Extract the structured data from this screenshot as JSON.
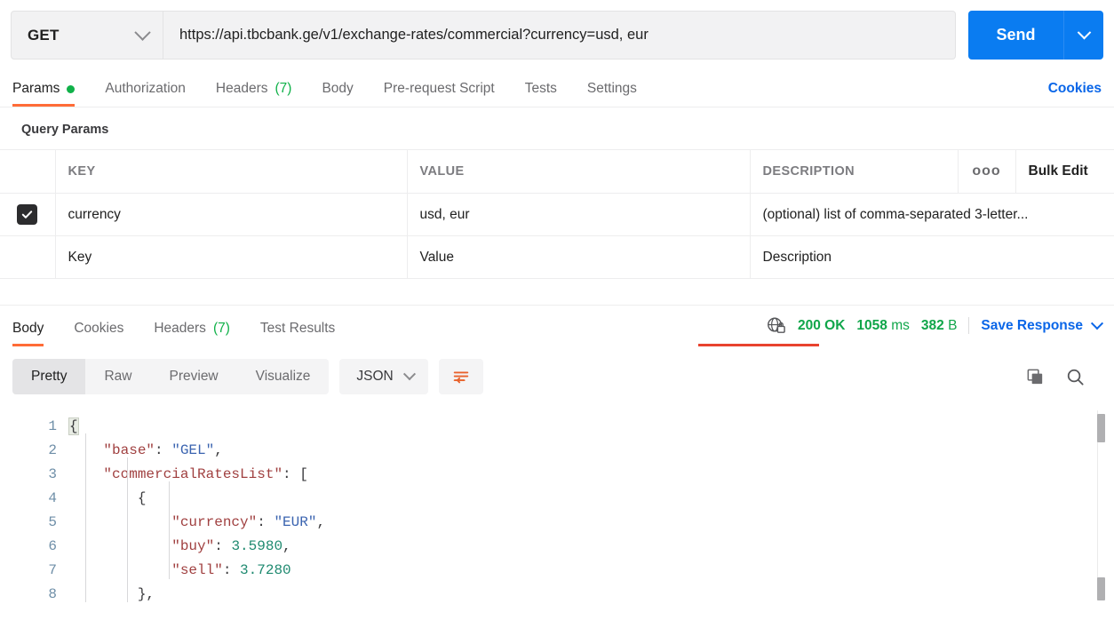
{
  "request": {
    "method": "GET",
    "url": "https://api.tbcbank.ge/v1/exchange-rates/commercial?currency=usd, eur",
    "send_label": "Send",
    "tabs": [
      {
        "label": "Params",
        "badge": "",
        "active": true,
        "dot": true
      },
      {
        "label": "Authorization",
        "badge": "",
        "active": false,
        "dot": false
      },
      {
        "label": "Headers",
        "badge": "(7)",
        "active": false,
        "dot": false
      },
      {
        "label": "Body",
        "badge": "",
        "active": false,
        "dot": false
      },
      {
        "label": "Pre-request Script",
        "badge": "",
        "active": false,
        "dot": false
      },
      {
        "label": "Tests",
        "badge": "",
        "active": false,
        "dot": false
      },
      {
        "label": "Settings",
        "badge": "",
        "active": false,
        "dot": false
      }
    ],
    "cookies_link": "Cookies"
  },
  "query_params": {
    "section_title": "Query Params",
    "columns": [
      "KEY",
      "VALUE",
      "DESCRIPTION"
    ],
    "options_glyph": "ooo",
    "bulk_edit_label": "Bulk Edit",
    "rows": [
      {
        "checked": true,
        "key": "currency",
        "value": "usd, eur",
        "description": "(optional) list of comma-separated 3-letter..."
      }
    ],
    "empty_row": {
      "key_placeholder": "Key",
      "value_placeholder": "Value",
      "description_placeholder": "Description"
    }
  },
  "response": {
    "tabs": [
      {
        "label": "Body",
        "badge": "",
        "active": true
      },
      {
        "label": "Cookies",
        "badge": "",
        "active": false
      },
      {
        "label": "Headers",
        "badge": "(7)",
        "active": false
      },
      {
        "label": "Test Results",
        "badge": "",
        "active": false
      }
    ],
    "status_code": "200 OK",
    "time": "1058",
    "time_unit": "ms",
    "size": "382",
    "size_unit": "B",
    "save_response_label": "Save Response",
    "security_icon": "globe-lock-icon",
    "view_modes": [
      {
        "label": "Pretty",
        "active": true
      },
      {
        "label": "Raw",
        "active": false
      },
      {
        "label": "Preview",
        "active": false
      },
      {
        "label": "Visualize",
        "active": false
      }
    ],
    "format": "JSON",
    "wrap_icon": "word-wrap-icon",
    "copy_icon": "copy-icon",
    "search_icon": "search-icon",
    "body_lines": [
      {
        "num": "1",
        "tokens": [
          {
            "t": "{",
            "c": "p brace-hl"
          }
        ]
      },
      {
        "num": "2",
        "tokens": [
          {
            "t": "    ",
            "c": "p"
          },
          {
            "t": "\"base\"",
            "c": "k"
          },
          {
            "t": ": ",
            "c": "p"
          },
          {
            "t": "\"GEL\"",
            "c": "s"
          },
          {
            "t": ",",
            "c": "p"
          }
        ]
      },
      {
        "num": "3",
        "tokens": [
          {
            "t": "    ",
            "c": "p"
          },
          {
            "t": "\"commercialRatesList\"",
            "c": "k"
          },
          {
            "t": ": [",
            "c": "p"
          }
        ]
      },
      {
        "num": "4",
        "tokens": [
          {
            "t": "        {",
            "c": "p"
          }
        ]
      },
      {
        "num": "5",
        "tokens": [
          {
            "t": "            ",
            "c": "p"
          },
          {
            "t": "\"currency\"",
            "c": "k"
          },
          {
            "t": ": ",
            "c": "p"
          },
          {
            "t": "\"EUR\"",
            "c": "s"
          },
          {
            "t": ",",
            "c": "p"
          }
        ]
      },
      {
        "num": "6",
        "tokens": [
          {
            "t": "            ",
            "c": "p"
          },
          {
            "t": "\"buy\"",
            "c": "k"
          },
          {
            "t": ": ",
            "c": "p"
          },
          {
            "t": "3.5980",
            "c": "n"
          },
          {
            "t": ",",
            "c": "p"
          }
        ]
      },
      {
        "num": "7",
        "tokens": [
          {
            "t": "            ",
            "c": "p"
          },
          {
            "t": "\"sell\"",
            "c": "k"
          },
          {
            "t": ": ",
            "c": "p"
          },
          {
            "t": "3.7280",
            "c": "n"
          }
        ]
      },
      {
        "num": "8",
        "tokens": [
          {
            "t": "        },",
            "c": "p"
          }
        ]
      }
    ]
  },
  "colors": {
    "accent_orange": "#ff6c37",
    "send_blue": "#0a7cf1",
    "link_blue": "#0a66e8",
    "status_green": "#10a64a",
    "red_underline": "#e8422e"
  }
}
